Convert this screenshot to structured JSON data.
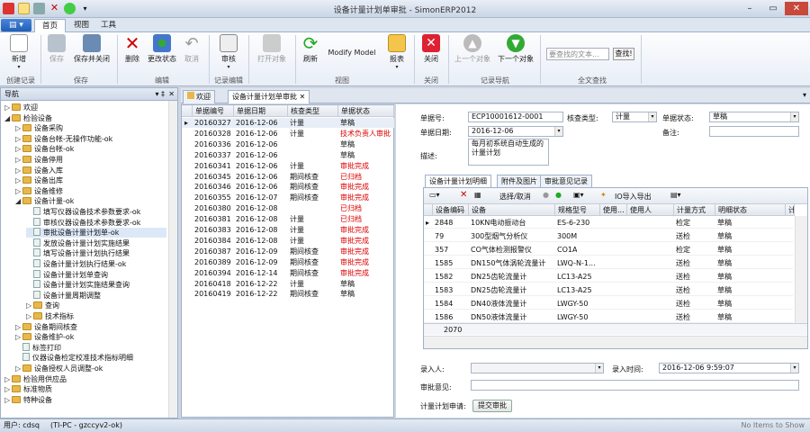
{
  "window": {
    "title": "设备计量计划单审批 - SimonERP2012"
  },
  "ribbon_tabs": [
    {
      "label": "首页"
    },
    {
      "label": "视图"
    },
    {
      "label": "工具"
    }
  ],
  "ribbon": {
    "new": "新增",
    "save": "保存",
    "save_close": "保存并关闭",
    "delete": "删除",
    "change_state": "更改状态",
    "cancel": "取消",
    "review": "审核",
    "open_obj": "打开对象",
    "refresh": "刷新",
    "modify_model": "Modify Model",
    "report": "报表",
    "close": "关闭",
    "prev": "上一个对象",
    "next": "下一个对象",
    "search_placeholder": "要查找的文本...",
    "find": "查找!",
    "groups": [
      "创建记录",
      "保存",
      "编辑",
      "记录编辑",
      "视图",
      "关闭",
      "记录导航",
      "全文查找"
    ]
  },
  "nav": {
    "title": "导航",
    "items": [
      {
        "label": "欢迎",
        "level": 0,
        "type": "folder"
      },
      {
        "label": "检验设备",
        "level": 0,
        "type": "folder",
        "expanded": true
      },
      {
        "label": "设备采购",
        "level": 1,
        "type": "folder"
      },
      {
        "label": "设备台帐-无操作功能-ok",
        "level": 1,
        "type": "folder"
      },
      {
        "label": "设备台帐-ok",
        "level": 1,
        "type": "folder"
      },
      {
        "label": "设备停用",
        "level": 1,
        "type": "folder"
      },
      {
        "label": "设备入库",
        "level": 1,
        "type": "folder"
      },
      {
        "label": "设备出库",
        "level": 1,
        "type": "folder"
      },
      {
        "label": "设备维修",
        "level": 1,
        "type": "folder"
      },
      {
        "label": "设备计量-ok",
        "level": 1,
        "type": "folder",
        "expanded": true
      },
      {
        "label": "填写仪器设备技术参数要求-ok",
        "level": 2,
        "type": "leaf"
      },
      {
        "label": "审核仪器设备技术参数要求-ok",
        "level": 2,
        "type": "leaf"
      },
      {
        "label": "审批设备计量计划单-ok",
        "level": 2,
        "type": "leaf",
        "selected": true
      },
      {
        "label": "发放设备计量计划实施结果",
        "level": 2,
        "type": "leaf"
      },
      {
        "label": "填写设备计量计划执行结果",
        "level": 2,
        "type": "leaf"
      },
      {
        "label": "设备计量计划执行结果-ok",
        "level": 2,
        "type": "leaf"
      },
      {
        "label": "设备计量计划单查询",
        "level": 2,
        "type": "leaf"
      },
      {
        "label": "设备计量计划实施结果查询",
        "level": 2,
        "type": "leaf"
      },
      {
        "label": "设备计量周期调整",
        "level": 2,
        "type": "leaf"
      },
      {
        "label": "查询",
        "level": 2,
        "type": "folder"
      },
      {
        "label": "技术指标",
        "level": 2,
        "type": "folder"
      },
      {
        "label": "设备期间核查",
        "level": 1,
        "type": "folder"
      },
      {
        "label": "设备维护-ok",
        "level": 1,
        "type": "folder"
      },
      {
        "label": "标签打印",
        "level": 1,
        "type": "leaf"
      },
      {
        "label": "仪器设备检定校准技术指标明细",
        "level": 1,
        "type": "leaf"
      },
      {
        "label": "设备授权人员调整-ok",
        "level": 1,
        "type": "folder"
      },
      {
        "label": "检验用供应品",
        "level": 0,
        "type": "folder"
      },
      {
        "label": "标准物质",
        "level": 0,
        "type": "folder"
      },
      {
        "label": "特种设备",
        "level": 0,
        "type": "folder"
      }
    ]
  },
  "doc_tabs": [
    {
      "label": "欢迎"
    },
    {
      "label": "设备计量计划单审批"
    }
  ],
  "list": {
    "columns": [
      "单据编号",
      "单据日期",
      "核查类型",
      "单据状态"
    ],
    "rows": [
      [
        "20160327",
        "2016-12-06",
        "计量",
        "草稿",
        false
      ],
      [
        "20160328",
        "2016-12-06",
        "计量",
        "技术负责人审批",
        true
      ],
      [
        "20160336",
        "2016-12-06",
        "",
        "草稿",
        false
      ],
      [
        "20160337",
        "2016-12-06",
        "",
        "草稿",
        false
      ],
      [
        "20160341",
        "2016-12-06",
        "计量",
        "审批完成",
        true
      ],
      [
        "20160345",
        "2016-12-06",
        "期间核查",
        "已归档",
        true
      ],
      [
        "20160346",
        "2016-12-06",
        "期间核查",
        "审批完成",
        true
      ],
      [
        "20160355",
        "2016-12-07",
        "期间核查",
        "审批完成",
        true
      ],
      [
        "20160380",
        "2016-12-08",
        "",
        "已归档",
        true
      ],
      [
        "20160381",
        "2016-12-08",
        "计量",
        "已归档",
        true
      ],
      [
        "20160383",
        "2016-12-08",
        "计量",
        "审批完成",
        true
      ],
      [
        "20160384",
        "2016-12-08",
        "计量",
        "审批完成",
        true
      ],
      [
        "20160387",
        "2016-12-09",
        "期间核查",
        "审批完成",
        true
      ],
      [
        "20160389",
        "2016-12-09",
        "期间核查",
        "审批完成",
        true
      ],
      [
        "20160394",
        "2016-12-14",
        "期间核查",
        "审批完成",
        true
      ],
      [
        "20160418",
        "2016-12-22",
        "计量",
        "草稿",
        false
      ],
      [
        "20160419",
        "2016-12-22",
        "期间核查",
        "草稿",
        false
      ]
    ]
  },
  "detail": {
    "doc_no_label": "单据号:",
    "doc_no": "ECP10001612-0001",
    "check_type_label": "核查类型:",
    "check_type": "计量",
    "doc_state_label": "单据状态:",
    "doc_state": "草稿",
    "doc_date_label": "单据日期:",
    "doc_date": "2016-12-06",
    "note_label": "备注:",
    "desc_label": "描述:",
    "desc": "每月初系统自动生成的计量计划",
    "sub_tabs": [
      {
        "label": "设备计量计划明细"
      },
      {
        "label": "附件及图片"
      },
      {
        "label": "审批意见记录"
      }
    ],
    "toolbar": {
      "select_cancel": "选择/取消",
      "import_export": "IO导入导出"
    },
    "sub_columns": [
      "设备编码",
      "设备",
      "规格型号",
      "使用...",
      "使用人",
      "计量方式",
      "明细状态",
      "计"
    ],
    "sub_rows": [
      [
        "2848",
        "10KN电动振动台",
        "ES-6-230",
        "",
        "",
        "检定",
        "草稿"
      ],
      [
        "79",
        "300型烟气分析仪",
        "300M",
        "",
        "",
        "送检",
        "草稿"
      ],
      [
        "357",
        "CO气体检测报警仪",
        "CO1A",
        "",
        "",
        "检定",
        "草稿"
      ],
      [
        "1585",
        "DN150气体涡轮流量计",
        "LWQ-N-1...",
        "",
        "",
        "送检",
        "草稿"
      ],
      [
        "1582",
        "DN25齿轮流量计",
        "LC13-A25",
        "",
        "",
        "送检",
        "草稿"
      ],
      [
        "1583",
        "DN25齿轮流量计",
        "LC13-A25",
        "",
        "",
        "送检",
        "草稿"
      ],
      [
        "1584",
        "DN40液体流量计",
        "LWGY-50",
        "",
        "",
        "送检",
        "草稿"
      ],
      [
        "1586",
        "DN50液体流量计",
        "LWGY-50",
        "",
        "",
        "送检",
        "草稿"
      ]
    ],
    "count": "2070",
    "entered_by_label": "录入人:",
    "entered_by": "",
    "entered_time_label": "录入时间:",
    "entered_time": "2016-12-06 9:59:07",
    "approval_label": "审批意见:",
    "approval": "",
    "apply_label": "计量计划申请:",
    "submit": "提交审批"
  },
  "status": {
    "user": "用户: cdsq",
    "host": "(TI-PC - gzccyv2-ok)",
    "right": "No Items to Show"
  }
}
